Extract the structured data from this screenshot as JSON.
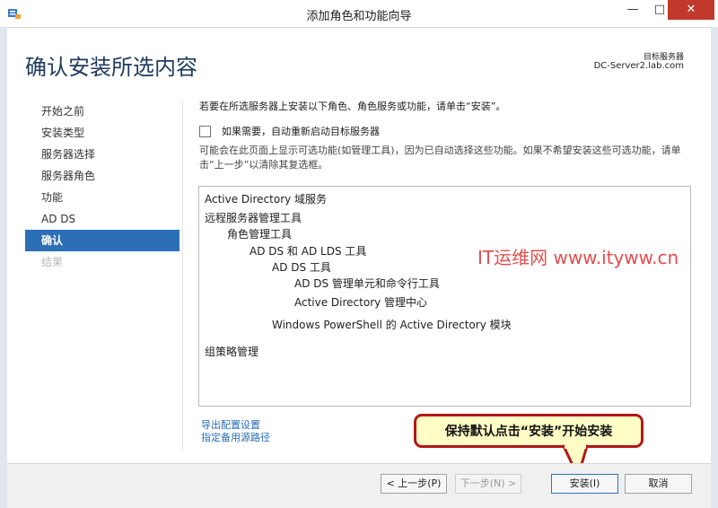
{
  "window": {
    "title": "添加角色和功能向导",
    "controls": {
      "minimize": "—",
      "maximize": "□",
      "close": "✕"
    }
  },
  "header": {
    "page_title": "确认安装所选内容",
    "destination_label": "目标服务器",
    "destination_server": "DC-Server2.lab.com"
  },
  "nav": {
    "items": [
      {
        "label": "开始之前",
        "state": "normal"
      },
      {
        "label": "安装类型",
        "state": "normal"
      },
      {
        "label": "服务器选择",
        "state": "normal"
      },
      {
        "label": "服务器角色",
        "state": "normal"
      },
      {
        "label": "功能",
        "state": "normal"
      },
      {
        "label": "AD DS",
        "state": "normal"
      },
      {
        "label": "确认",
        "state": "active"
      },
      {
        "label": "结果",
        "state": "disabled"
      }
    ]
  },
  "main": {
    "intro": "若要在所选服务器上安装以下角色、角色服务或功能，请单击“安装”。",
    "restart_label": "如果需要，自动重新启动目标服务器",
    "restart_checked": false,
    "note": "可能会在此页面上显示可选功能(如管理工具)，因为已自动选择这些功能。如果不希望安装这些可选功能，请单击“上一步”以清除其复选框。",
    "features": [
      {
        "label": "Active Directory 域服务",
        "level": 0
      },
      {
        "label": "远程服务器管理工具",
        "level": 0
      },
      {
        "label": "角色管理工具",
        "level": 1
      },
      {
        "label": "AD DS 和 AD LDS 工具",
        "level": 2
      },
      {
        "label": "AD DS 工具",
        "level": 3
      },
      {
        "label": "AD DS 管理单元和命令行工具",
        "level": 4
      },
      {
        "label": "Active Directory 管理中心",
        "level": 4
      },
      {
        "label": "Windows PowerShell 的 Active Directory 模块",
        "level": 3
      },
      {
        "label": "组策略管理",
        "level": 0
      }
    ],
    "links": {
      "export": "导出配置设置",
      "alternate_source": "指定备用源路径"
    }
  },
  "callout": {
    "text": "保持默认点击“安装”开始安装"
  },
  "watermark": "IT运维网 www.ityww.cn",
  "buttons": {
    "previous": "< 上一步(P)",
    "next": "下一步(N) >",
    "install": "安装(I)",
    "cancel": "取消"
  },
  "colors": {
    "accent": "#2c6fb6",
    "link": "#2a6db5",
    "callout_border": "#b31717",
    "callout_fill": "#fffcc6",
    "close_button": "#c0392b"
  }
}
